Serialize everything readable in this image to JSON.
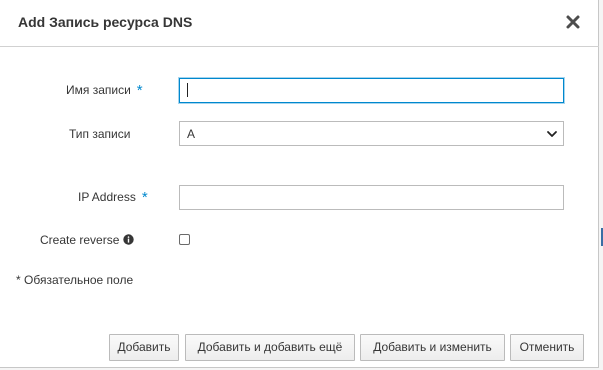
{
  "dialog": {
    "title": "Add Запись ресурса DNS",
    "close_icon": "close-icon"
  },
  "form": {
    "record_name": {
      "label": "Имя записи",
      "required_mark": "*",
      "value": ""
    },
    "record_type": {
      "label": "Тип записи",
      "selected": "A",
      "icon": "chevron-down-icon"
    },
    "ip_address": {
      "label": "IP Address",
      "required_mark": "*",
      "value": ""
    },
    "create_reverse": {
      "label": "Create reverse",
      "checked": false,
      "icon": "info-circle-icon"
    }
  },
  "required_note": "* Обязательное поле",
  "buttons": {
    "add": "Добавить",
    "add_and_add_another": "Добавить и добавить ещё",
    "add_and_edit": "Добавить и изменить",
    "cancel": "Отменить"
  },
  "colors": {
    "required_asterisk": "#0088ce",
    "focus_border": "#0088ce",
    "text": "#363636"
  }
}
